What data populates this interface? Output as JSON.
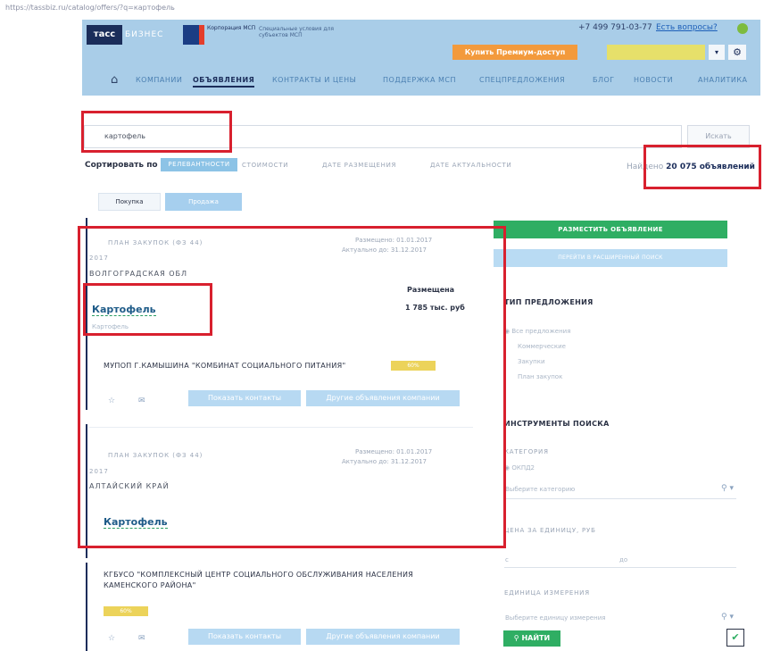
{
  "browser": {
    "url": "https://tassbiz.ru/catalog/offers/?q=картофель"
  },
  "header": {
    "logo": "тасс",
    "logo_sub": "БИЗНЕС",
    "corp_title": "Корпорация МСП",
    "corp_desc": "Специальные условия для субъектов МСП",
    "phone": "+7 499 791-03-77",
    "help": "Есть вопросы?",
    "premium": "Купить Премиум-доступ",
    "caret": "▾",
    "gear": "⚙",
    "home": "⌂"
  },
  "nav": [
    {
      "label": "КОМПАНИИ"
    },
    {
      "label": "ОБЪЯВЛЕНИЯ"
    },
    {
      "label": "КОНТРАКТЫ И ЦЕНЫ"
    },
    {
      "label": "ПОДДЕРЖКА МСП"
    },
    {
      "label": "СПЕЦПРЕДЛОЖЕНИЯ"
    },
    {
      "label": "БЛОГ"
    },
    {
      "label": "НОВОСТИ"
    },
    {
      "label": "АНАЛИТИКА"
    }
  ],
  "search": {
    "value": "картофель",
    "button": "Искать"
  },
  "sort": {
    "label": "Сортировать по",
    "active": "РЕЛЕВАНТНОСТИ",
    "options": [
      "СТОИМОСТИ",
      "ДАТЕ РАЗМЕЩЕНИЯ",
      "ДАТЕ АКТУАЛЬНОСТИ"
    ]
  },
  "found": {
    "prefix": "Найдено",
    "count": "20 075 объявлений"
  },
  "tabs": {
    "buy": "Покупка",
    "sell": "Продажа"
  },
  "listings": [
    {
      "tag": "ПЛАН ЗАКУПОК (ФЗ 44)",
      "date_placed": "Размещено: 01.01.2017",
      "date_actual": "Актуально до: 31.12.2017",
      "year": "2017",
      "region": "ВОЛГОГРАДСКАЯ ОБЛ",
      "title": "Картофель",
      "subtitle": "Картофель",
      "placed_label": "Размещена",
      "amount": "1 785 тыс. руб",
      "company": "МУПОП Г.КАМЫШИНА \"КОМБИНАТ СОЦИАЛЬНОГО ПИТАНИЯ\"",
      "pct": "60%",
      "contacts_btn": "Показать контакты",
      "other_btn": "Другие объявления компании"
    },
    {
      "tag": "ПЛАН ЗАКУПОК (ФЗ 44)",
      "date_placed": "Размещено: 01.01.2017",
      "date_actual": "Актуально до: 31.12.2017",
      "year": "2017",
      "region": "АЛТАЙСКИЙ КРАЙ",
      "title": "Картофель",
      "company": "КГБУСО \"КОМПЛЕКСНЫЙ ЦЕНТР СОЦИАЛЬНОГО ОБСЛУЖИВАНИЯ НАСЕЛЕНИЯ КАМЕНСКОГО РАЙОНА\"",
      "pct": "60%",
      "contacts_btn": "Показать контакты",
      "other_btn": "Другие объявления компании"
    }
  ],
  "sidebar": {
    "post_btn": "РАЗМЕСТИТЬ ОБЪЯВЛЕНИЕ",
    "advanced_btn": "ПЕРЕЙТИ В РАСШИРЕННЫЙ ПОИСК",
    "offer_type_title": "ТИП ПРЕДЛОЖЕНИЯ",
    "offer_types": [
      "Все предложения",
      "Коммерческие",
      "Закупки",
      "План закупок"
    ],
    "tools_title": "ИНСТРУМЕНТЫ ПОИСКА",
    "category_label": "КАТЕГОРИЯ",
    "category_opt": "ОКПД2",
    "category_placeholder": "Выберите категорию",
    "price_label": "ЦЕНА ЗА ЕДИНИЦУ, РУБ",
    "price_from": "с",
    "price_to": "до",
    "unit_label": "ЕДИНИЦА ИЗМЕРЕНИЯ",
    "unit_placeholder": "Выберите единицу измерения",
    "find_btn": "НАЙТИ",
    "search_icon": "🔍",
    "check": "✔"
  }
}
